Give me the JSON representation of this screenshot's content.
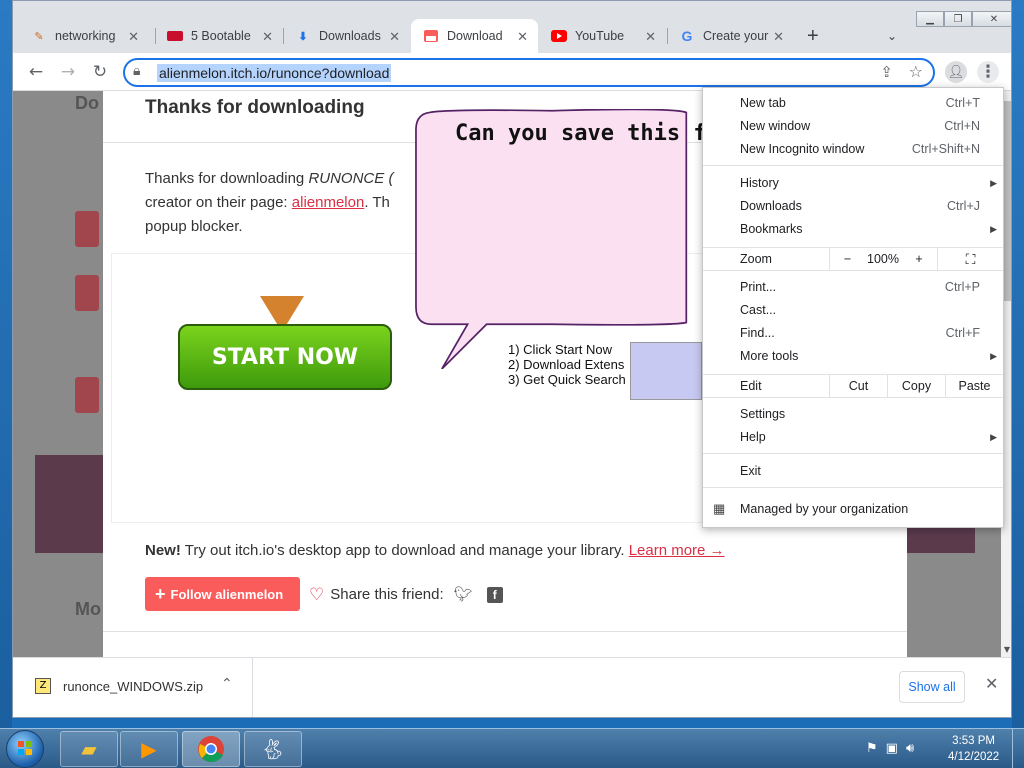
{
  "tabs": [
    {
      "title": "networking",
      "icon": "pen-icon"
    },
    {
      "title": "5 Bootable",
      "icon": "pcgamer-icon"
    },
    {
      "title": "Downloads",
      "icon": "download-icon"
    },
    {
      "title": "Download R",
      "icon": "itch-icon",
      "active": true
    },
    {
      "title": "YouTube",
      "icon": "youtube-icon"
    },
    {
      "title": "Create your",
      "icon": "google-icon"
    }
  ],
  "toolbar": {
    "url": "alienmelon.itch.io/runonce?download"
  },
  "page": {
    "title": "Thanks for downloading",
    "line1_a": "Thanks for downloading ",
    "line1_game": "RUNONCE (",
    "line2_a": "creator on their page: ",
    "line2_link": "alienmelon",
    "line2_b": ". Th",
    "line3": "popup blocker.",
    "start_button": "START NOW",
    "steps": [
      "1)  Click  Start Now",
      "2)  Download Extens",
      "3)  Get Quick Search"
    ],
    "new_label": "New!",
    "new_text": " Try out itch.io's desktop app to download and manage your library. ",
    "learn_more": "Learn more →",
    "follow_button": "Follow alienmelon",
    "share_label": "Share this friend:",
    "bubble_text": "Can you save this fo"
  },
  "menu": {
    "new_tab": "New tab",
    "new_tab_sc": "Ctrl+T",
    "new_window": "New window",
    "new_window_sc": "Ctrl+N",
    "incognito": "New Incognito window",
    "incognito_sc": "Ctrl+Shift+N",
    "history": "History",
    "downloads": "Downloads",
    "downloads_sc": "Ctrl+J",
    "bookmarks": "Bookmarks",
    "zoom": "Zoom",
    "zoom_minus": "−",
    "zoom_value": "100%",
    "zoom_plus": "+",
    "print": "Print...",
    "print_sc": "Ctrl+P",
    "cast": "Cast...",
    "find": "Find...",
    "find_sc": "Ctrl+F",
    "more_tools": "More tools",
    "edit": "Edit",
    "cut": "Cut",
    "copy": "Copy",
    "paste": "Paste",
    "settings": "Settings",
    "help": "Help",
    "exit": "Exit",
    "managed": "Managed by your organization"
  },
  "shelf": {
    "file": "runonce_WINDOWS.zip",
    "show_all": "Show all"
  },
  "clock": {
    "time": "3:53 PM",
    "date": "4/12/2022"
  }
}
